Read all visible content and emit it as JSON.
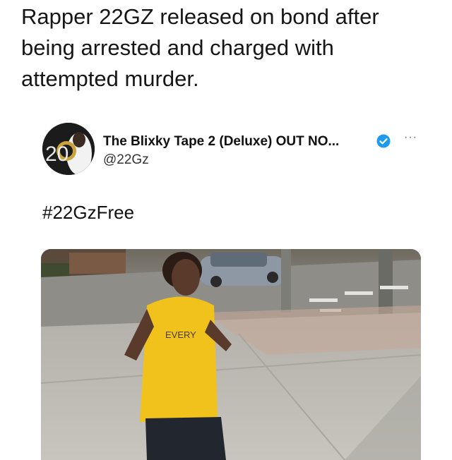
{
  "headline": {
    "line1": "Rapper 22GZ released on bond after",
    "line2": "being arrested and charged with",
    "line3": "attempted murder."
  },
  "tweet": {
    "display_name": "The Blixky Tape 2 (Deluxe) OUT NO...",
    "handle": "@22Gz",
    "more_label": "···",
    "text": "#22GzFree",
    "verified_color": "#1d9bf0",
    "avatar_text": "20",
    "shirt_text": "EVERY"
  }
}
